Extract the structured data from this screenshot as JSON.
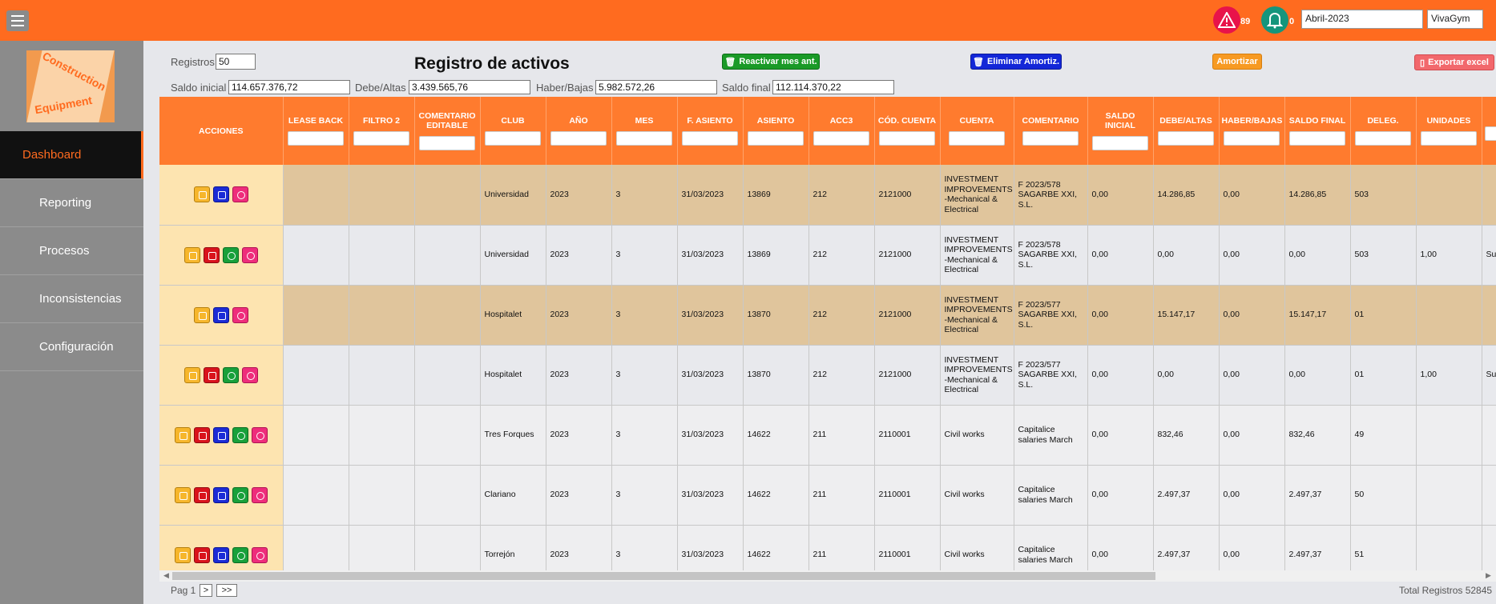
{
  "topbar": {
    "alerts_count": "89",
    "notifications_count": "0",
    "period": "Abril-2023",
    "company": "VivaGym"
  },
  "sidebar": {
    "logo_line1": "Construction",
    "logo_line2": "Equipment",
    "items": [
      {
        "label": "Dashboard"
      },
      {
        "label": "Reporting"
      },
      {
        "label": "Procesos"
      },
      {
        "label": "Inconsistencias"
      },
      {
        "label": "Configuración"
      }
    ]
  },
  "main": {
    "registros_label": "Registros",
    "registros_value": "50",
    "title": "Registro de activos",
    "buttons": {
      "reactivar": "Reactivar mes ant.",
      "eliminar": "Eliminar Amortiz.",
      "amortizar": "Amortizar",
      "exportar": "Exportar excel"
    },
    "summary": {
      "saldo_inicial_label": "Saldo inicial",
      "saldo_inicial": "114.657.376,72",
      "debe_label": "Debe/Altas",
      "debe": "3.439.565,76",
      "haber_label": "Haber/Bajas",
      "haber": "5.982.572,26",
      "saldo_final_label": "Saldo final",
      "saldo_final": "112.114.370,22"
    }
  },
  "table": {
    "columns": [
      "ACCIONES",
      "LEASE BACK",
      "FILTRO 2",
      "COMENTARIO EDITABLE",
      "CLUB",
      "AÑO",
      "MES",
      "F. ASIENTO",
      "ASIENTO",
      "ACC3",
      "CÓD. CUENTA",
      "CUENTA",
      "COMENTARIO",
      "SALDO INICIAL",
      "DEBE/ALTAS",
      "HABER/BAJAS",
      "SALDO FINAL",
      "DELEG.",
      "UNIDADES",
      ""
    ],
    "rows": [
      {
        "style": "tan",
        "actions": [
          "edit",
          "tree",
          "cancel"
        ],
        "club": "Universidad",
        "anio": "2023",
        "mes": "3",
        "fecha": "31/03/2023",
        "asiento": "13869",
        "acc3": "212",
        "cod": "2121000",
        "cuenta": "INVESTMENT IMPROVEMENTS -Mechanical & Electrical",
        "comentario": "F 2023/578 SAGARBE XXI, S.L.",
        "saldo_ini": "0,00",
        "debe": "14.286,85",
        "haber": "0,00",
        "saldo_fin": "14.286,85",
        "deleg": "503",
        "unidades": "",
        "extra": ""
      },
      {
        "style": "grey",
        "actions": [
          "edit",
          "del",
          "sync",
          "cancel"
        ],
        "club": "Universidad",
        "anio": "2023",
        "mes": "3",
        "fecha": "31/03/2023",
        "asiento": "13869",
        "acc3": "212",
        "cod": "2121000",
        "cuenta": "INVESTMENT IMPROVEMENTS -Mechanical & Electrical",
        "comentario": "F 2023/578 SAGARBE XXI, S.L.",
        "saldo_ini": "0,00",
        "debe": "0,00",
        "haber": "0,00",
        "saldo_fin": "0,00",
        "deleg": "503",
        "unidades": "1,00",
        "extra": "Su in nu"
      },
      {
        "style": "tan",
        "actions": [
          "edit",
          "tree",
          "cancel"
        ],
        "club": "Hospitalet",
        "anio": "2023",
        "mes": "3",
        "fecha": "31/03/2023",
        "asiento": "13870",
        "acc3": "212",
        "cod": "2121000",
        "cuenta": "INVESTMENT IMPROVEMENTS -Mechanical & Electrical",
        "comentario": "F 2023/577 SAGARBE XXI, S.L.",
        "saldo_ini": "0,00",
        "debe": "15.147,17",
        "haber": "0,00",
        "saldo_fin": "15.147,17",
        "deleg": "01",
        "unidades": "",
        "extra": ""
      },
      {
        "style": "grey",
        "actions": [
          "edit",
          "del",
          "sync",
          "cancel"
        ],
        "club": "Hospitalet",
        "anio": "2023",
        "mes": "3",
        "fecha": "31/03/2023",
        "asiento": "13870",
        "acc3": "212",
        "cod": "2121000",
        "cuenta": "INVESTMENT IMPROVEMENTS -Mechanical & Electrical",
        "comentario": "F 2023/577 SAGARBE XXI, S.L.",
        "saldo_ini": "0,00",
        "debe": "0,00",
        "haber": "0,00",
        "saldo_fin": "0,00",
        "deleg": "01",
        "unidades": "1,00",
        "extra": "Su in nu"
      },
      {
        "style": "white",
        "actions": [
          "edit",
          "del",
          "tree",
          "sync",
          "cancel"
        ],
        "club": "Tres Forques",
        "anio": "2023",
        "mes": "3",
        "fecha": "31/03/2023",
        "asiento": "14622",
        "acc3": "211",
        "cod": "2110001",
        "cuenta": "Civil works",
        "comentario": "Capitalice salaries March",
        "saldo_ini": "0,00",
        "debe": "832,46",
        "haber": "0,00",
        "saldo_fin": "832,46",
        "deleg": "49",
        "unidades": "",
        "extra": ""
      },
      {
        "style": "white",
        "actions": [
          "edit",
          "del",
          "tree",
          "sync",
          "cancel"
        ],
        "club": "Clariano",
        "anio": "2023",
        "mes": "3",
        "fecha": "31/03/2023",
        "asiento": "14622",
        "acc3": "211",
        "cod": "2110001",
        "cuenta": "Civil works",
        "comentario": "Capitalice salaries March",
        "saldo_ini": "0,00",
        "debe": "2.497,37",
        "haber": "0,00",
        "saldo_fin": "2.497,37",
        "deleg": "50",
        "unidades": "",
        "extra": ""
      },
      {
        "style": "white",
        "actions": [
          "edit",
          "del",
          "tree",
          "sync",
          "cancel"
        ],
        "club": "Torrejón",
        "anio": "2023",
        "mes": "3",
        "fecha": "31/03/2023",
        "asiento": "14622",
        "acc3": "211",
        "cod": "2110001",
        "cuenta": "Civil works",
        "comentario": "Capitalice salaries March",
        "saldo_ini": "0,00",
        "debe": "2.497,37",
        "haber": "0,00",
        "saldo_fin": "2.497,37",
        "deleg": "51",
        "unidades": "",
        "extra": ""
      }
    ]
  },
  "footer": {
    "page_label": "Pag 1",
    "next": ">",
    "last": ">>",
    "total": "Total Registros 52845"
  },
  "colors": {
    "brand": "#ff6b1f",
    "sidebar": "#8b8b8b",
    "row_highlight": "#e0c59c",
    "actions_cell": "#fde4b0"
  }
}
